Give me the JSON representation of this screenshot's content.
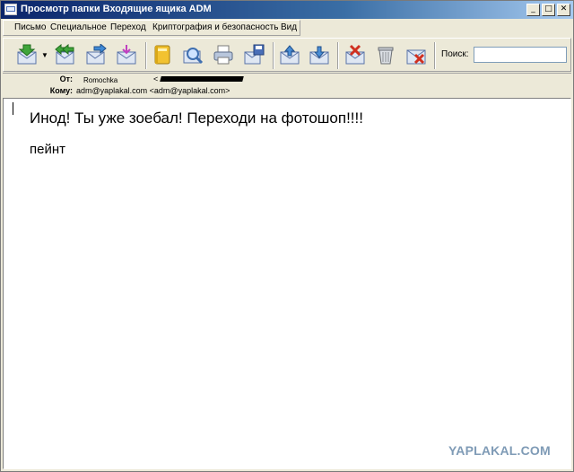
{
  "window": {
    "title": "Просмотр папки Входящие ящика ADM",
    "minimize": "_",
    "maximize": "□",
    "close": "✕"
  },
  "menu": {
    "items": [
      "Письмо",
      "Специальное",
      "Переход",
      "Криптография и безопасность",
      "Вид"
    ]
  },
  "toolbar": {
    "buttons": [
      {
        "icon": "get-mail-icon"
      },
      {
        "icon": "reply-all-icon"
      },
      {
        "icon": "forward-icon"
      },
      {
        "icon": "new-message-icon"
      },
      {
        "icon": "address-book-icon"
      },
      {
        "icon": "search-mail-icon"
      },
      {
        "icon": "print-icon"
      },
      {
        "icon": "save-icon"
      },
      {
        "icon": "move-up-icon"
      },
      {
        "icon": "move-down-icon"
      },
      {
        "icon": "delete-mark-icon"
      },
      {
        "icon": "trash-icon"
      },
      {
        "icon": "junk-icon"
      }
    ],
    "search_label": "Поиск:",
    "search_value": ""
  },
  "header": {
    "from_label": "От:",
    "from_name": "Romochka",
    "from_email_prefix": "<",
    "to_label": "Кому:",
    "to_value": "adm@yaplakal.com <adm@yaplakal.com>"
  },
  "message": {
    "line1": "Инод! Ты уже зоебал! Переходи на фотошоп!!!!",
    "line2": "пейнт"
  },
  "watermark": "YAPLAKAL.COM",
  "colors": {
    "titlebar_start": "#0a246a",
    "titlebar_end": "#a6caf0",
    "chrome": "#ece9d8",
    "watermark": "#7f9bb6"
  }
}
